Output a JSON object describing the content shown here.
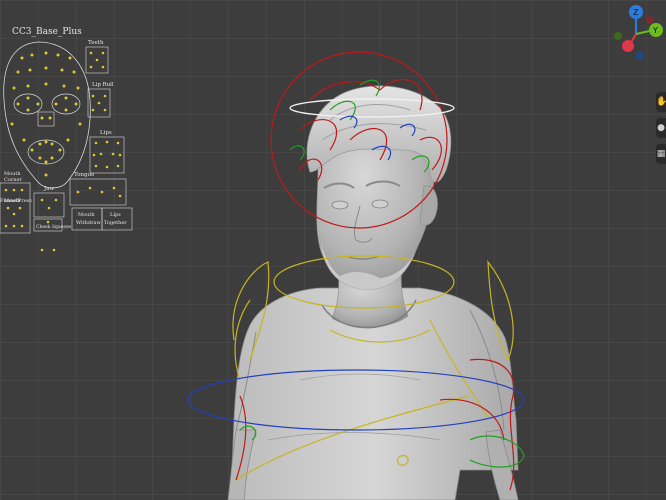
{
  "viewport": {
    "background": "#3d3d3d",
    "rig_colors": {
      "head": "#c01818",
      "spine": "#c8b420",
      "ik": "#20a020",
      "fk": "#2040c0",
      "halo": "#f0f0f0"
    }
  },
  "face_picker": {
    "title": "CC3_Base_Plus",
    "labels": {
      "teeth": "Teeth",
      "lip_roll": "Lip Roll",
      "lips": "Lips",
      "tongue": "Tongue",
      "jaw": "Jaw",
      "mouth_corner": "Mouth",
      "mouth_corner2": "Corner",
      "funnel": "Funnel",
      "press": "Press",
      "mouth_widen": "Mouth",
      "mouth_widen2": "Widen",
      "cheek_squeeze": "Cheek Squeeze",
      "mouth_withdraw": "Mouth",
      "mouth_withdraw2": "Withdraw",
      "lips_together": "Lips",
      "lips_together2": "Together"
    }
  },
  "gizmo": {
    "axis_z": "Z",
    "axis_y": "Y",
    "colors": {
      "x": "#e0384a",
      "y": "#6cbc1c",
      "z": "#2c7ce0",
      "neg": "#4a4a4a"
    }
  },
  "side_controls": [
    {
      "icon": "hand-icon",
      "glyph": "✋"
    },
    {
      "icon": "camera-icon",
      "glyph": "●"
    },
    {
      "icon": "grid-icon",
      "glyph": "▦"
    }
  ]
}
